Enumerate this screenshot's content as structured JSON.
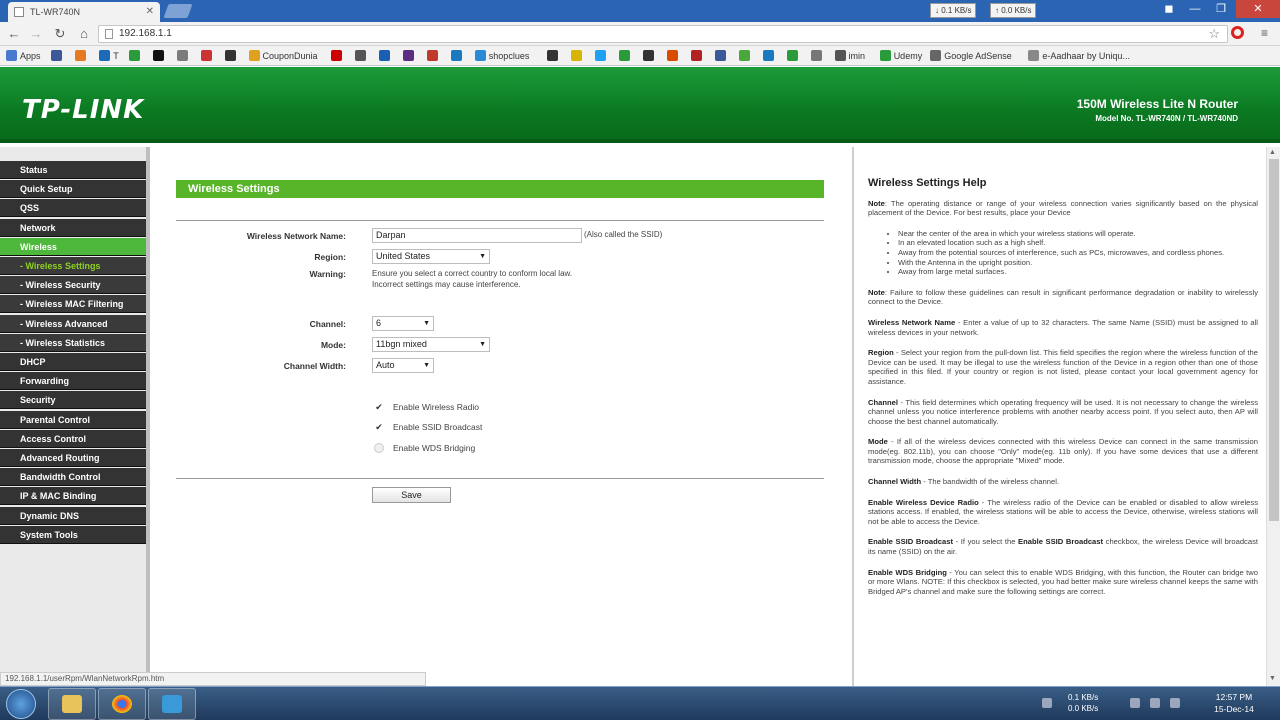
{
  "browser": {
    "tab_title": "TL-WR740N",
    "url": "192.168.1.1",
    "speed_down": "0.1 KB/s",
    "speed_up": "0.0 KB/s"
  },
  "bookmarks": [
    {
      "label": "Apps",
      "color": "#4a7ad0"
    },
    {
      "label": "",
      "color": "#3b5998"
    },
    {
      "label": "",
      "color": "#e57a22"
    },
    {
      "label": "T",
      "color": "#1c6bb8"
    },
    {
      "label": "",
      "color": "#2a9b3a"
    },
    {
      "label": "",
      "color": "#111111"
    },
    {
      "label": "",
      "color": "#7b7b7b"
    },
    {
      "label": "",
      "color": "#cc3333"
    },
    {
      "label": "",
      "color": "#333333"
    },
    {
      "label": "CouponDunia",
      "color": "#e0a020"
    },
    {
      "label": "",
      "color": "#cc0000"
    },
    {
      "label": "",
      "color": "#555555"
    },
    {
      "label": "",
      "color": "#1a5fb4"
    },
    {
      "label": "",
      "color": "#5a2d82"
    },
    {
      "label": "",
      "color": "#c0392b"
    },
    {
      "label": "",
      "color": "#1a7ac0"
    },
    {
      "label": "shopclues",
      "color": "#2a8ad6"
    },
    {
      "label": "",
      "color": "#333333"
    },
    {
      "label": "",
      "color": "#d9b400"
    },
    {
      "label": "",
      "color": "#1da1f2"
    },
    {
      "label": "",
      "color": "#2a9b3a"
    },
    {
      "label": "",
      "color": "#333333"
    },
    {
      "label": "",
      "color": "#d94c00"
    },
    {
      "label": "",
      "color": "#b22222"
    },
    {
      "label": "",
      "color": "#3b5998"
    },
    {
      "label": "",
      "color": "#4aa83a"
    },
    {
      "label": "",
      "color": "#1a7ac0"
    },
    {
      "label": "",
      "color": "#2a9b3a"
    },
    {
      "label": "",
      "color": "#777777"
    },
    {
      "label": "imin",
      "color": "#555555"
    },
    {
      "label": "Udemy",
      "color": "#2a9b3a"
    },
    {
      "label": "Google AdSense",
      "color": "#666666"
    },
    {
      "label": "e-Aadhaar by Uniqu...",
      "color": "#888888"
    }
  ],
  "header": {
    "logo": "TP-LINK",
    "product": "150M Wireless Lite N Router",
    "model": "Model No. TL-WR740N / TL-WR740ND"
  },
  "menu": [
    {
      "label": "Status",
      "sub": false,
      "state": ""
    },
    {
      "label": "Quick Setup",
      "sub": false,
      "state": ""
    },
    {
      "label": "QSS",
      "sub": false,
      "state": ""
    },
    {
      "label": "Network",
      "sub": false,
      "state": ""
    },
    {
      "label": "Wireless",
      "sub": false,
      "state": "active"
    },
    {
      "label": "- Wireless Settings",
      "sub": true,
      "state": "current"
    },
    {
      "label": "- Wireless Security",
      "sub": true,
      "state": ""
    },
    {
      "label": "- Wireless MAC Filtering",
      "sub": true,
      "state": ""
    },
    {
      "label": "- Wireless Advanced",
      "sub": true,
      "state": ""
    },
    {
      "label": "- Wireless Statistics",
      "sub": true,
      "state": ""
    },
    {
      "label": "DHCP",
      "sub": false,
      "state": ""
    },
    {
      "label": "Forwarding",
      "sub": false,
      "state": ""
    },
    {
      "label": "Security",
      "sub": false,
      "state": ""
    },
    {
      "label": "Parental Control",
      "sub": false,
      "state": ""
    },
    {
      "label": "Access Control",
      "sub": false,
      "state": ""
    },
    {
      "label": "Advanced Routing",
      "sub": false,
      "state": ""
    },
    {
      "label": "Bandwidth Control",
      "sub": false,
      "state": ""
    },
    {
      "label": "IP & MAC Binding",
      "sub": false,
      "state": ""
    },
    {
      "label": "Dynamic DNS",
      "sub": false,
      "state": ""
    },
    {
      "label": "System Tools",
      "sub": false,
      "state": ""
    }
  ],
  "form": {
    "title": "Wireless Settings",
    "ssid_label": "Wireless Network Name:",
    "ssid_value": "Darpan",
    "ssid_hint": "(Also called the SSID)",
    "region_label": "Region:",
    "region_value": "United States",
    "warning_label": "Warning:",
    "warning_line1": "Ensure you select a correct country to conform local law.",
    "warning_line2": "Incorrect settings may cause interference.",
    "channel_label": "Channel:",
    "channel_value": "6",
    "mode_label": "Mode:",
    "mode_value": "11bgn mixed",
    "width_label": "Channel Width:",
    "width_value": "Auto",
    "enable_radio": "Enable Wireless Radio",
    "enable_radio_checked": true,
    "enable_ssid": "Enable SSID Broadcast",
    "enable_ssid_checked": true,
    "enable_wds": "Enable WDS Bridging",
    "enable_wds_checked": false,
    "save": "Save"
  },
  "help": {
    "title": "Wireless Settings Help",
    "note1_label": "Note",
    "note1": ": The operating distance or range of your wireless connection varies significantly based on the physical placement of the Device. For best results, place your Device",
    "bullets": [
      "Near the center of the area in which your wireless stations will operate.",
      "In an elevated location such as a high shelf.",
      "Away from the potential sources of interference, such as PCs, microwaves, and cordless phones.",
      "With the Antenna in the upright position.",
      "Away from large metal surfaces."
    ],
    "note2_label": "Note",
    "note2": ": Failure to follow these guidelines can result in significant performance degradation or inability to wirelessly connect to the Device.",
    "name_label": "Wireless Network Name",
    "name_text": " - Enter a value of up to 32 characters. The same Name (SSID) must be assigned to all wireless devices in your network.",
    "region_label": "Region",
    "region_text": " - Select your region from the pull-down list. This field specifies the region where the wireless function of the Device can be used. It may be illegal to use the wireless function of the Device in a region other than one of those specified in this filed. If your country or region is not listed, please contact your local government agency for assistance.",
    "channel_label": "Channel",
    "channel_text": " - This field determines which operating frequency will be used. It is not necessary to change the wireless channel unless you notice interference problems with another nearby access point. If you select auto, then AP will choose the best channel automatically.",
    "mode_label": "Mode",
    "mode_text": " - If all of the wireless devices connected with this wireless Device can connect in the same transmission mode(eg. 802.11b), you can choose \"Only\" mode(eg. 11b only). If you have some devices that use a different transmission mode, choose the appropriate \"Mixed\" mode.",
    "width_label": "Channel Width",
    "width_text": " - The bandwidth of the wireless channel.",
    "radio_label": "Enable Wireless Device Radio",
    "radio_text": " - The wireless radio of the Device can be enabled or disabled to allow wireless stations access. If enabled, the wireless stations will be able to access the Device, otherwise, wireless stations will not be able to access the Device.",
    "ssidb_label": "Enable SSID Broadcast",
    "ssidb_mid_label": "Enable SSID Broadcast",
    "ssidb_pre": " - If you select the ",
    "ssidb_text": " checkbox, the wireless Device will broadcast its name (SSID) on the air.",
    "wds_label": "Enable WDS Bridging",
    "wds_text": " - You can select this to enable WDS Bridging, with this function, the Router can bridge two or more Wlans. NOTE: If this checkbox is selected, you had better make sure wireless channel keeps the same with Bridged AP's channel and make sure the following settings are correct."
  },
  "status_url": "192.168.1.1/userRpm/WlanNetworkRpm.htm",
  "taskbar": {
    "speed_down": "0.1 KB/s",
    "speed_up": "0.0 KB/s",
    "time": "12:57 PM",
    "date": "15-Dec-14"
  }
}
